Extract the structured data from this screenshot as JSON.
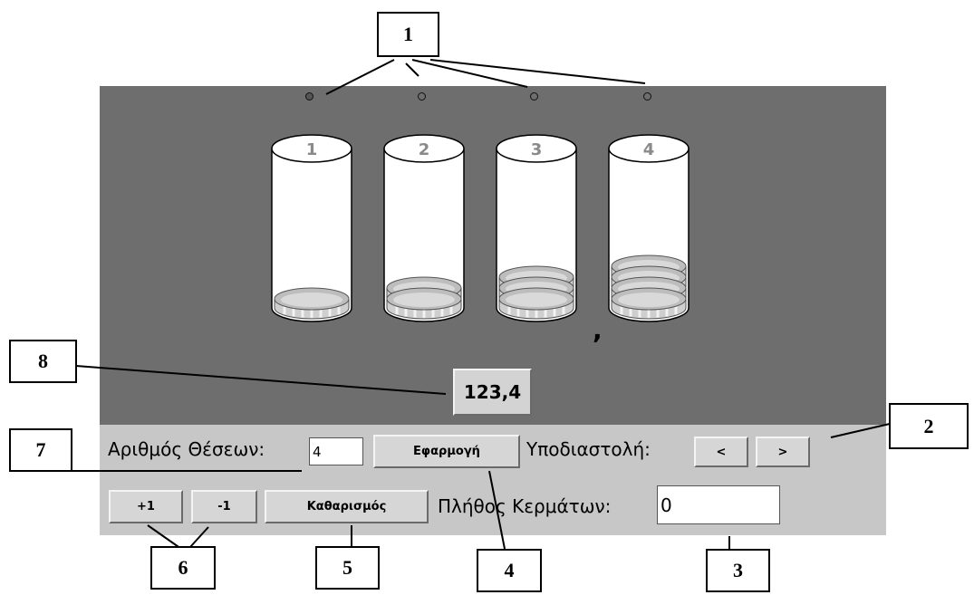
{
  "callouts": [
    "1",
    "2",
    "3",
    "4",
    "5",
    "6",
    "7",
    "8"
  ],
  "positions": [
    {
      "label": "1",
      "active": true
    },
    {
      "label": "2",
      "active": false
    },
    {
      "label": "3",
      "active": false
    },
    {
      "label": "4",
      "active": false
    }
  ],
  "coin_counts": [
    1,
    2,
    3,
    4
  ],
  "decimal_mark": ",",
  "display_value": "123,4",
  "controls": {
    "positions_label": "Αριθμός Θέσεων:",
    "positions_value": "4",
    "apply_button": "Εφαρμογή",
    "decimal_label": "Υποδιαστολή:",
    "decimal_left": "<",
    "decimal_right": ">",
    "plus_button": "+1",
    "minus_button": "-1",
    "clear_button": "Καθαρισμός",
    "coins_label": "Πλήθος Κερμάτων:",
    "coins_value": "0"
  },
  "colors": {
    "stage": "#6e6e6e",
    "panel": "#c7c7c7",
    "active_dot": "#555555"
  }
}
